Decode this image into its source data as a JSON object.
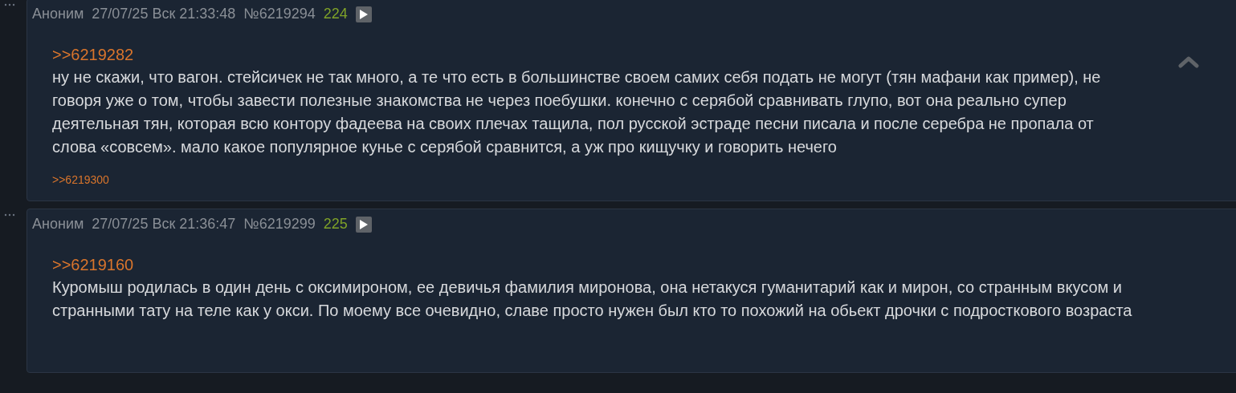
{
  "posts": [
    {
      "author": "Аноним",
      "date": "27/07/25 Вск 21:33:48",
      "number": "№6219294",
      "count": "224",
      "hovered": true,
      "quote": ">>6219282",
      "text": "ну не скажи, что вагон. стейсичек не так много, а те что есть в большинстве своем самих себя подать не могут (тян мафани как пример), не говоря уже о том, чтобы завести полезные знакомства не через поебушки. конечно с серябой сравнивать глупо, вот она реально супер деятельная тян, которая всю контору фадеева на своих плечах тащила, пол русской эстраде песни писала и после серебра не пропала от слова «совсем». мало какое популярное кунье с серябой сравнится, а уж про кищучку и говорить нечего",
      "replies": [
        ">>6219300"
      ]
    },
    {
      "author": "Аноним",
      "date": "27/07/25 Вск 21:36:47",
      "number": "№6219299",
      "count": "225",
      "hovered": false,
      "quote": ">>6219160",
      "text": "Куромыш родилась в один день с оксимироном, ее девичья фамилия миронова, она нетакуся гуманитарий как и мирон, со странным вкусом и странными тату на теле как у окси. По моему все очевидно, славе просто нужен был кто то похожий на обьект дрочки с подросткового возраста"
    }
  ]
}
